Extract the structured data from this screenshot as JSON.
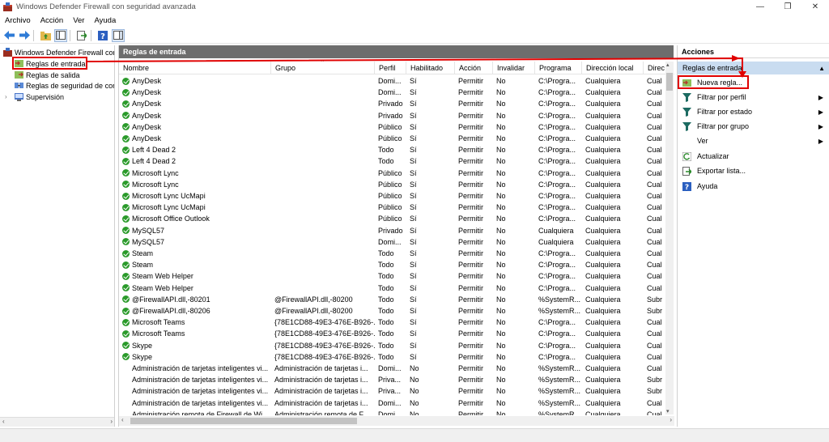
{
  "window": {
    "title": "Windows Defender Firewall con seguridad avanzada"
  },
  "menu": [
    "Archivo",
    "Acción",
    "Ver",
    "Ayuda"
  ],
  "tree": {
    "root": "Windows Defender Firewall con",
    "items": [
      "Reglas de entrada",
      "Reglas de salida",
      "Reglas de seguridad de con",
      "Supervisión"
    ]
  },
  "center": {
    "header": "Reglas de entrada",
    "columns": [
      "Nombre",
      "Grupo",
      "Perfil",
      "Habilitado",
      "Acción",
      "Invalidar",
      "Programa",
      "Dirección local",
      "Direc"
    ],
    "rows": [
      [
        "AnyDesk",
        "",
        "Domi...",
        "Sí",
        "Permitir",
        "No",
        "C:\\Progra...",
        "Cualquiera",
        "Cual",
        true
      ],
      [
        "AnyDesk",
        "",
        "Domi...",
        "Sí",
        "Permitir",
        "No",
        "C:\\Progra...",
        "Cualquiera",
        "Cual",
        true
      ],
      [
        "AnyDesk",
        "",
        "Privado",
        "Sí",
        "Permitir",
        "No",
        "C:\\Progra...",
        "Cualquiera",
        "Cual",
        true
      ],
      [
        "AnyDesk",
        "",
        "Privado",
        "Sí",
        "Permitir",
        "No",
        "C:\\Progra...",
        "Cualquiera",
        "Cual",
        true
      ],
      [
        "AnyDesk",
        "",
        "Público",
        "Sí",
        "Permitir",
        "No",
        "C:\\Progra...",
        "Cualquiera",
        "Cual",
        true
      ],
      [
        "AnyDesk",
        "",
        "Público",
        "Sí",
        "Permitir",
        "No",
        "C:\\Progra...",
        "Cualquiera",
        "Cual",
        true
      ],
      [
        "Left 4 Dead 2",
        "",
        "Todo",
        "Sí",
        "Permitir",
        "No",
        "C:\\Progra...",
        "Cualquiera",
        "Cual",
        true
      ],
      [
        "Left 4 Dead 2",
        "",
        "Todo",
        "Sí",
        "Permitir",
        "No",
        "C:\\Progra...",
        "Cualquiera",
        "Cual",
        true
      ],
      [
        "Microsoft Lync",
        "",
        "Público",
        "Sí",
        "Permitir",
        "No",
        "C:\\Progra...",
        "Cualquiera",
        "Cual",
        true
      ],
      [
        "Microsoft Lync",
        "",
        "Público",
        "Sí",
        "Permitir",
        "No",
        "C:\\Progra...",
        "Cualquiera",
        "Cual",
        true
      ],
      [
        "Microsoft Lync UcMapi",
        "",
        "Público",
        "Sí",
        "Permitir",
        "No",
        "C:\\Progra...",
        "Cualquiera",
        "Cual",
        true
      ],
      [
        "Microsoft Lync UcMapi",
        "",
        "Público",
        "Sí",
        "Permitir",
        "No",
        "C:\\Progra...",
        "Cualquiera",
        "Cual",
        true
      ],
      [
        "Microsoft Office Outlook",
        "",
        "Público",
        "Sí",
        "Permitir",
        "No",
        "C:\\Progra...",
        "Cualquiera",
        "Cual",
        true
      ],
      [
        "MySQL57",
        "",
        "Privado",
        "Sí",
        "Permitir",
        "No",
        "Cualquiera",
        "Cualquiera",
        "Cual",
        true
      ],
      [
        "MySQL57",
        "",
        "Domi...",
        "Sí",
        "Permitir",
        "No",
        "Cualquiera",
        "Cualquiera",
        "Cual",
        true
      ],
      [
        "Steam",
        "",
        "Todo",
        "Sí",
        "Permitir",
        "No",
        "C:\\Progra...",
        "Cualquiera",
        "Cual",
        true
      ],
      [
        "Steam",
        "",
        "Todo",
        "Sí",
        "Permitir",
        "No",
        "C:\\Progra...",
        "Cualquiera",
        "Cual",
        true
      ],
      [
        "Steam Web Helper",
        "",
        "Todo",
        "Sí",
        "Permitir",
        "No",
        "C:\\Progra...",
        "Cualquiera",
        "Cual",
        true
      ],
      [
        "Steam Web Helper",
        "",
        "Todo",
        "Sí",
        "Permitir",
        "No",
        "C:\\Progra...",
        "Cualquiera",
        "Cual",
        true
      ],
      [
        "@FirewallAPI.dll,-80201",
        "@FirewallAPI.dll,-80200",
        "Todo",
        "Sí",
        "Permitir",
        "No",
        "%SystemR...",
        "Cualquiera",
        "Subr",
        true
      ],
      [
        "@FirewallAPI.dll,-80206",
        "@FirewallAPI.dll,-80200",
        "Todo",
        "Sí",
        "Permitir",
        "No",
        "%SystemR...",
        "Cualquiera",
        "Subr",
        true
      ],
      [
        "Microsoft Teams",
        "{78E1CD88-49E3-476E-B926-...",
        "Todo",
        "Sí",
        "Permitir",
        "No",
        "C:\\Progra...",
        "Cualquiera",
        "Cual",
        true
      ],
      [
        "Microsoft Teams",
        "{78E1CD88-49E3-476E-B926-...",
        "Todo",
        "Sí",
        "Permitir",
        "No",
        "C:\\Progra...",
        "Cualquiera",
        "Cual",
        true
      ],
      [
        "Skype",
        "{78E1CD88-49E3-476E-B926-...",
        "Todo",
        "Sí",
        "Permitir",
        "No",
        "C:\\Progra...",
        "Cualquiera",
        "Cual",
        true
      ],
      [
        "Skype",
        "{78E1CD88-49E3-476E-B926-...",
        "Todo",
        "Sí",
        "Permitir",
        "No",
        "C:\\Progra...",
        "Cualquiera",
        "Cual",
        true
      ],
      [
        "Administración de tarjetas inteligentes vi...",
        "Administración de tarjetas i...",
        "Domi...",
        "No",
        "Permitir",
        "No",
        "%SystemR...",
        "Cualquiera",
        "Cual",
        false
      ],
      [
        "Administración de tarjetas inteligentes vi...",
        "Administración de tarjetas i...",
        "Priva...",
        "No",
        "Permitir",
        "No",
        "%SystemR...",
        "Cualquiera",
        "Subr",
        false
      ],
      [
        "Administración de tarjetas inteligentes vi...",
        "Administración de tarjetas i...",
        "Priva...",
        "No",
        "Permitir",
        "No",
        "%SystemR...",
        "Cualquiera",
        "Subr",
        false
      ],
      [
        "Administración de tarjetas inteligentes vi...",
        "Administración de tarjetas i...",
        "Domi...",
        "No",
        "Permitir",
        "No",
        "%SystemR...",
        "Cualquiera",
        "Cual",
        false
      ],
      [
        "Administración remota de Firewall de Wi...",
        "Administración remota de F...",
        "Domi...",
        "No",
        "Permitir",
        "No",
        "%SystemR...",
        "Cualquiera",
        "Cual",
        false
      ]
    ]
  },
  "actions": {
    "header": "Acciones",
    "section": "Reglas de entrada",
    "items": [
      {
        "label": "Nueva regla...",
        "icon": "new-rule-icon",
        "arrow": false
      },
      {
        "label": "Filtrar por perfil",
        "icon": "filter-icon",
        "arrow": true
      },
      {
        "label": "Filtrar por estado",
        "icon": "filter-icon",
        "arrow": true
      },
      {
        "label": "Filtrar por grupo",
        "icon": "filter-icon",
        "arrow": true
      },
      {
        "label": "Ver",
        "icon": "",
        "arrow": true
      },
      {
        "label": "Actualizar",
        "icon": "refresh-icon",
        "arrow": false
      },
      {
        "label": "Exportar lista...",
        "icon": "export-icon",
        "arrow": false
      },
      {
        "label": "Ayuda",
        "icon": "help-icon",
        "arrow": false
      }
    ]
  },
  "colors": {
    "accent": "#e00000",
    "section_bg": "#c9dcf0",
    "header_bg": "#6d6d6d",
    "check": "#2a9a2a"
  }
}
